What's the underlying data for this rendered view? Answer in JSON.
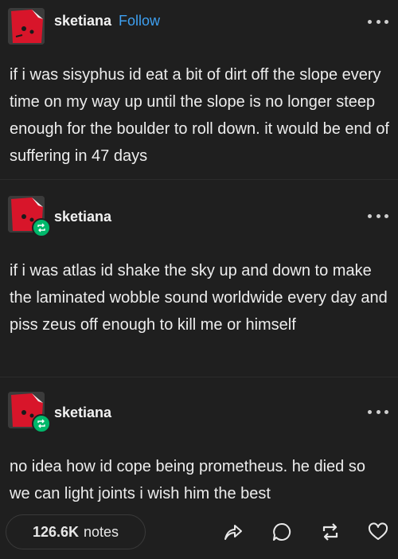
{
  "posts": [
    {
      "username": "sketiana",
      "follow_label": "Follow",
      "reblog": false,
      "text": "if i was sisyphus id eat a bit of dirt off the slope every time on my way up until the slope is no longer steep enough for the boulder to roll down. it would be end of suffering in 47 days"
    },
    {
      "username": "sketiana",
      "reblog": true,
      "text": "if i was atlas id shake the sky up and down to make the laminated wobble sound worldwide every day and piss zeus off enough to kill me or himself"
    },
    {
      "username": "sketiana",
      "reblog": true,
      "text": "no idea how id cope being prometheus. he died so we can light joints i wish him the best"
    }
  ],
  "footer": {
    "notes_count": "126.6K",
    "notes_label": "notes",
    "actions": [
      "share-icon",
      "reply-icon",
      "reblog-icon",
      "like-icon"
    ]
  },
  "colors": {
    "background": "#1f1f1f",
    "follow": "#3ea0f0",
    "reblog_badge": "#00b86b",
    "avatar_red": "#d8152a"
  }
}
